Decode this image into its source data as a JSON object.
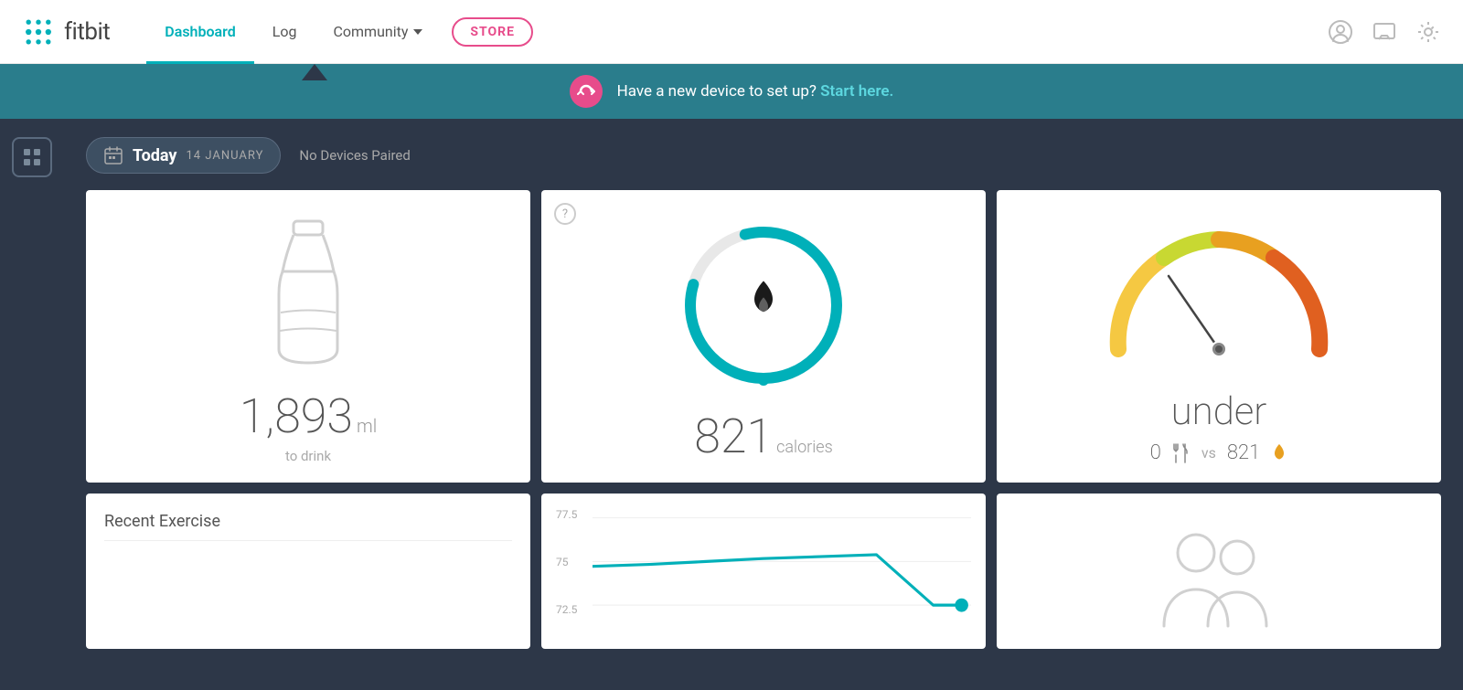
{
  "header": {
    "logo_text": "fitbit",
    "nav": {
      "dashboard": "Dashboard",
      "log": "Log",
      "community": "Community",
      "store": "STORE"
    }
  },
  "notification": {
    "text": "Have a new device to set up?",
    "link": "Start here."
  },
  "date_bar": {
    "today": "Today",
    "date": "14 JANUARY",
    "no_devices": "No Devices Paired"
  },
  "water_card": {
    "value": "1,893",
    "unit": "ml",
    "label": "to drink"
  },
  "calories_card": {
    "value": "821",
    "unit": "calories"
  },
  "gauge_card": {
    "label": "under",
    "food": "0",
    "vs": "vs",
    "burned": "821"
  },
  "exercise_card": {
    "title": "Recent Exercise"
  },
  "chart_card": {
    "y_labels": [
      "77.5",
      "75",
      "72.5"
    ]
  },
  "icons": {
    "calendar": "📅",
    "grid": "▦",
    "message": "💬",
    "settings": "⚙",
    "user": "👤",
    "link": "🔗"
  }
}
